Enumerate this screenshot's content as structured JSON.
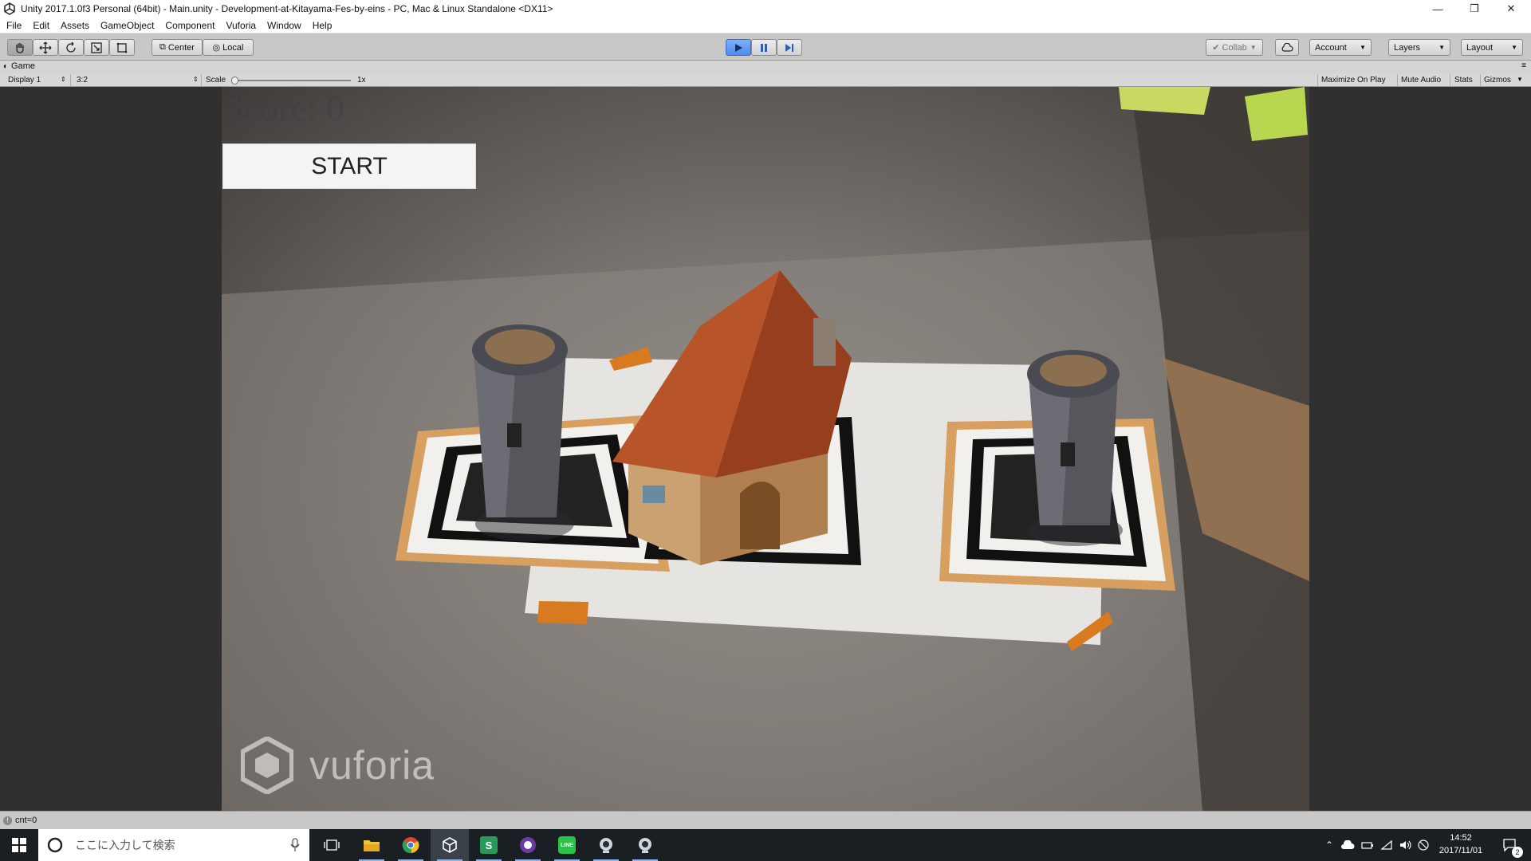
{
  "window": {
    "title": "Unity 2017.1.0f3 Personal (64bit) - Main.unity - Development-at-Kitayama-Fes-by-eins - PC, Mac & Linux Standalone <DX11>",
    "minimize": "—",
    "restore": "❐",
    "close": "✕"
  },
  "menu": [
    "File",
    "Edit",
    "Assets",
    "GameObject",
    "Component",
    "Vuforia",
    "Window",
    "Help"
  ],
  "toolbar": {
    "pivot": "Center",
    "space": "Local",
    "collab": "Collab",
    "account": "Account",
    "layers": "Layers",
    "layout": "Layout",
    "play_active": true
  },
  "game_view": {
    "tab": "Game",
    "display": "Display 1",
    "aspect": "3:2",
    "scale_label": "Scale",
    "scale_value": "1x",
    "maximize": "Maximize On Play",
    "mute": "Mute Audio",
    "stats": "Stats",
    "gizmos": "Gizmos"
  },
  "game": {
    "score": "Score: 0",
    "start_button": "START",
    "vuforia_logo": "vuforia"
  },
  "status": {
    "message": "cnt=0"
  },
  "taskbar": {
    "search_placeholder": "ここに入力して検索",
    "time": "14:52",
    "date": "2017/11/01",
    "notifications": "2"
  },
  "colors": {
    "play_active": "#4f8aec",
    "taskbar": "#1a1f24"
  }
}
